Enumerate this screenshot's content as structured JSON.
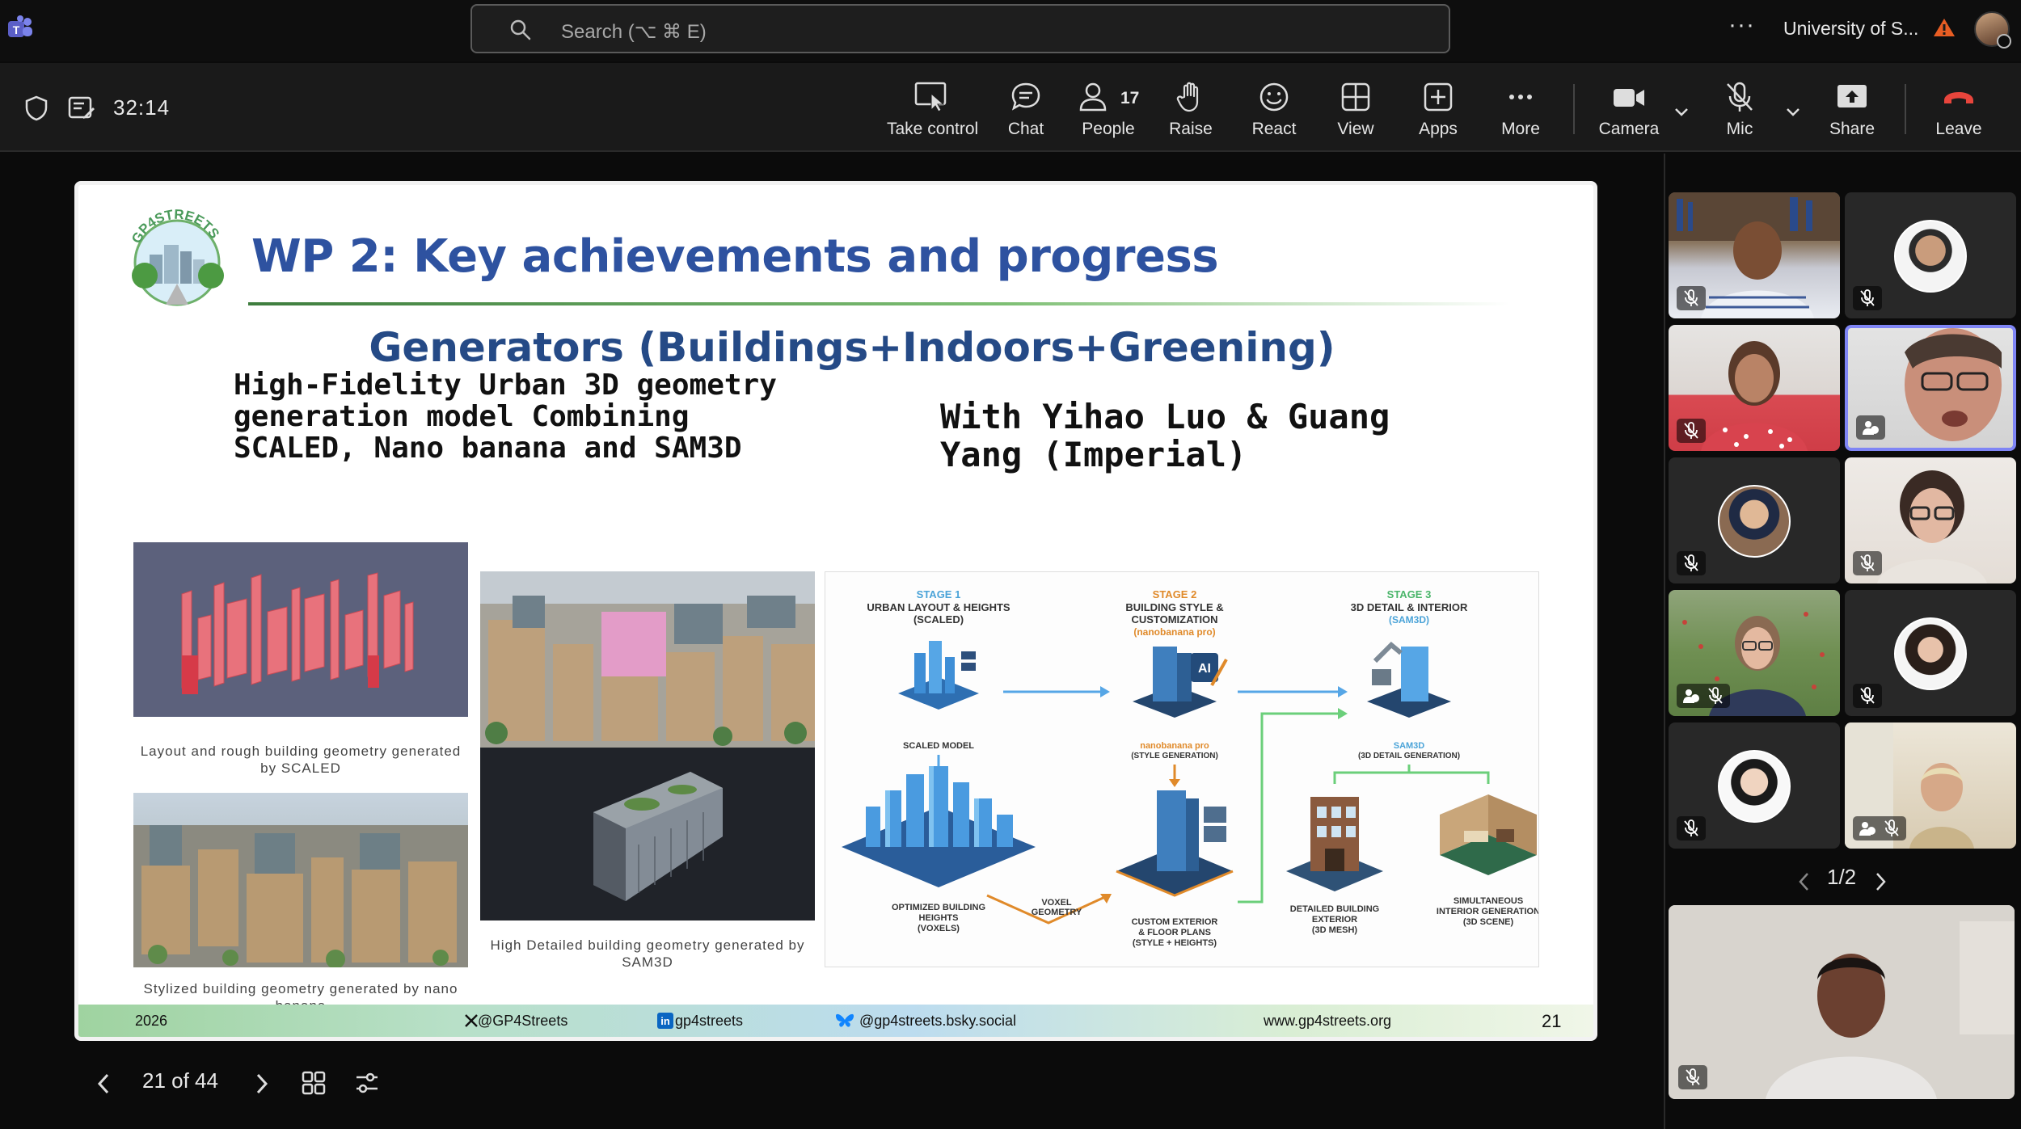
{
  "topbar": {
    "search_placeholder": "Search (⌥ ⌘ E)",
    "more_label": "···",
    "org_name": "University of S..."
  },
  "toolbar": {
    "timer": "32:14",
    "take_control": "Take control",
    "chat": "Chat",
    "people": "People",
    "people_count": "17",
    "raise": "Raise",
    "react": "React",
    "view": "View",
    "apps": "Apps",
    "more": "More",
    "camera": "Camera",
    "mic": "Mic",
    "share": "Share",
    "leave": "Leave"
  },
  "slide": {
    "title": "WP 2: Key achievements and progress",
    "subtitle": "Generators (Buildings+Indoors+Greening)",
    "left_heading": "High-Fidelity Urban 3D geometry generation model Combining SCALED, Nano banana and SAM3D",
    "right_heading": "With Yihao Luo & Guang Yang (Imperial)",
    "caption_1": "Layout and rough building geometry generated by SCALED",
    "caption_2": "High Detailed building geometry generated by SAM3D",
    "caption_3": "Stylized building geometry generated by nano banana",
    "diagram": {
      "stage1": "STAGE 1",
      "stage1_title": "URBAN LAYOUT & HEIGHTS",
      "stage1_sub": "(SCALED)",
      "stage2": "STAGE 2",
      "stage2_title": "BUILDING STYLE &",
      "stage2_title2": "CUSTOMIZATION",
      "stage2_sub": "(nanobanana pro)",
      "stage3": "STAGE 3",
      "stage3_title": "3D DETAIL & INTERIOR",
      "stage3_sub": "(SAM3D)",
      "scaled_model": "SCALED MODEL",
      "nano_label": "nanobanana pro",
      "nano_sub": "(STYLE GENERATION)",
      "sam_label": "SAM3D",
      "sam_sub": "(3D DETAIL GENERATION)",
      "voxel": "VOXEL",
      "voxel2": "GEOMETRY",
      "opt1": "OPTIMIZED BUILDING",
      "opt2": "HEIGHTS",
      "opt3": "(VOXELS)",
      "cust1": "CUSTOM EXTERIOR",
      "cust2": "& FLOOR PLANS",
      "cust3": "(STYLE + HEIGHTS)",
      "det1": "DETAILED BUILDING",
      "det2": "EXTERIOR",
      "det3": "(3D MESH)",
      "sim1": "SIMULTANEOUS",
      "sim2": "INTERIOR GENERATION",
      "sim3": "(3D SCENE)",
      "ai_badge": "AI"
    },
    "footer": {
      "year": "2026",
      "x_handle": "@GP4Streets",
      "linkedin": "gp4streets",
      "bluesky": "@gp4streets.bsky.social",
      "website": "www.gp4streets.org",
      "page": "21"
    }
  },
  "stage_nav": {
    "page_indicator": "21 of 44"
  },
  "participants": {
    "pager": "1/2"
  },
  "colors": {
    "accent": "#7f85f5",
    "leave_red": "#e8453c",
    "warning": "#e85d23",
    "slide_title": "#2e52a0"
  }
}
